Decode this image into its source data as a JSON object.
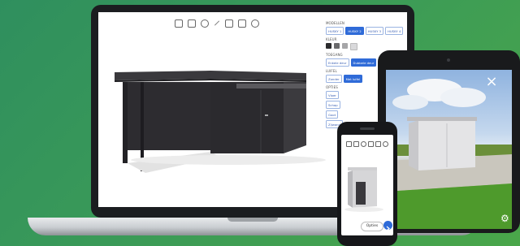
{
  "laptop": {
    "panel": {
      "sections": [
        {
          "heading": "MODELLEN",
          "options": [
            {
              "label": "HUSKY 1",
              "selected": false
            },
            {
              "label": "HUSKY 2",
              "selected": true
            },
            {
              "label": "HUSKY 3",
              "selected": false
            },
            {
              "label": "HUSKY 4",
              "selected": false
            }
          ]
        },
        {
          "heading": "KLEUR",
          "swatches": [
            "#2b2b2d",
            "#6a6a6c",
            "#a6a6a8",
            "#d9d9db"
          ]
        },
        {
          "heading": "TOEGANG",
          "options": [
            {
              "label": "Enkele deur",
              "selected": false
            },
            {
              "label": "Dubbele deur",
              "selected": true
            }
          ]
        },
        {
          "heading": "LUIFEL",
          "options": [
            {
              "label": "Zonder",
              "selected": false
            },
            {
              "label": "Met luifel",
              "selected": true
            }
          ]
        },
        {
          "heading": "OPTIES",
          "options": [
            {
              "label": "Vloer",
              "selected": false
            },
            {
              "label": "Schap",
              "selected": false
            },
            {
              "label": "Goot",
              "selected": false
            },
            {
              "label": "Zijwand",
              "selected": false
            }
          ]
        }
      ]
    },
    "toolbar_icons": [
      "box-icon",
      "cube-icon",
      "zoom-icon",
      "pen-icon",
      "list-icon",
      "expand-icon",
      "rotate-icon"
    ]
  },
  "phone": {
    "options_label": "Opties"
  },
  "colors": {
    "background_green": "#3a9a58",
    "accent_blue": "#2f6bd8",
    "shed_dark": "#2d2c30",
    "shed_light": "#e6e6e8"
  }
}
